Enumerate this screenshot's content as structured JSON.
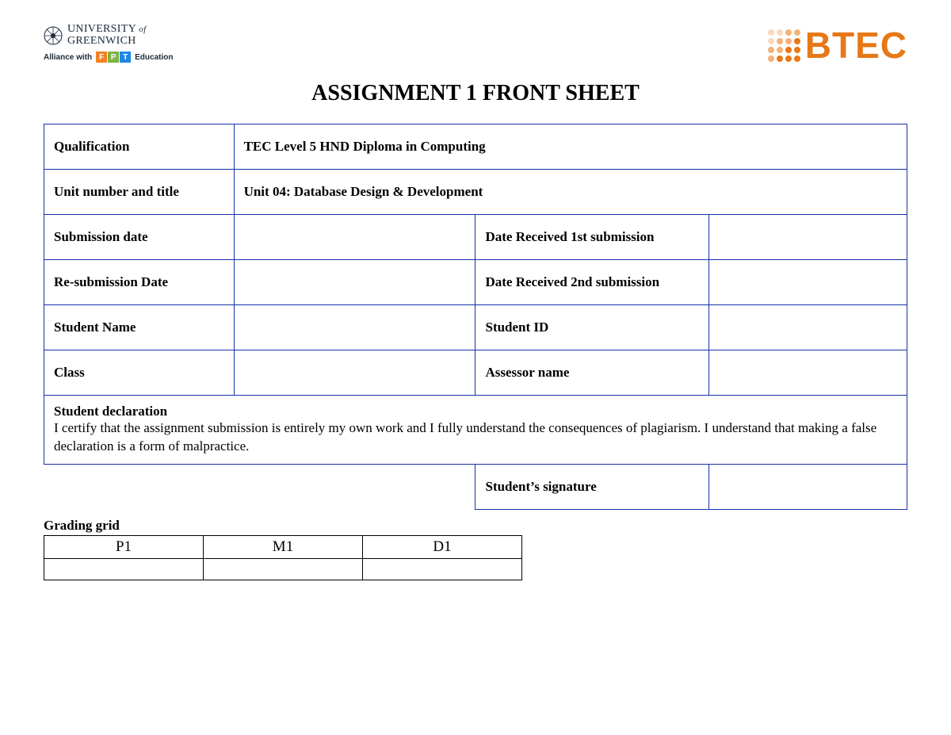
{
  "logos": {
    "greenwich_line1_a": "UNIVERSITY",
    "greenwich_line1_b": "of",
    "greenwich_line2": "GREENWICH",
    "alliance_prefix": "Alliance with",
    "fpt_letters": {
      "f": "F",
      "p": "P",
      "t": "T"
    },
    "alliance_suffix": "Education",
    "btec": "BTEC"
  },
  "title": "ASSIGNMENT 1 FRONT SHEET",
  "form": {
    "qualification_label": "Qualification",
    "qualification_value": "TEC Level 5 HND Diploma in Computing",
    "unit_label": "Unit number and title",
    "unit_value": "Unit 04: Database Design & Development",
    "submission_date_label": "Submission date",
    "submission_date_value": "",
    "date_received_1_label": "Date Received 1st submission",
    "date_received_1_value": "",
    "resubmission_date_label": "Re-submission Date",
    "resubmission_date_value": "",
    "date_received_2_label": "Date Received 2nd submission",
    "date_received_2_value": "",
    "student_name_label": "Student Name",
    "student_name_value": "",
    "student_id_label": "Student ID",
    "student_id_value": "",
    "class_label": "Class",
    "class_value": "",
    "assessor_name_label": "Assessor name",
    "assessor_name_value": "",
    "declaration_title": "Student declaration",
    "declaration_body": "I certify that the assignment submission is entirely my own work and I fully understand the consequences of plagiarism. I understand that making a false declaration is a form of malpractice.",
    "signature_label": "Student’s signature",
    "signature_value": ""
  },
  "grading": {
    "title": "Grading grid",
    "headers": {
      "p1": "P1",
      "m1": "M1",
      "d1": "D1"
    },
    "values": {
      "p1": "",
      "m1": "",
      "d1": ""
    }
  }
}
